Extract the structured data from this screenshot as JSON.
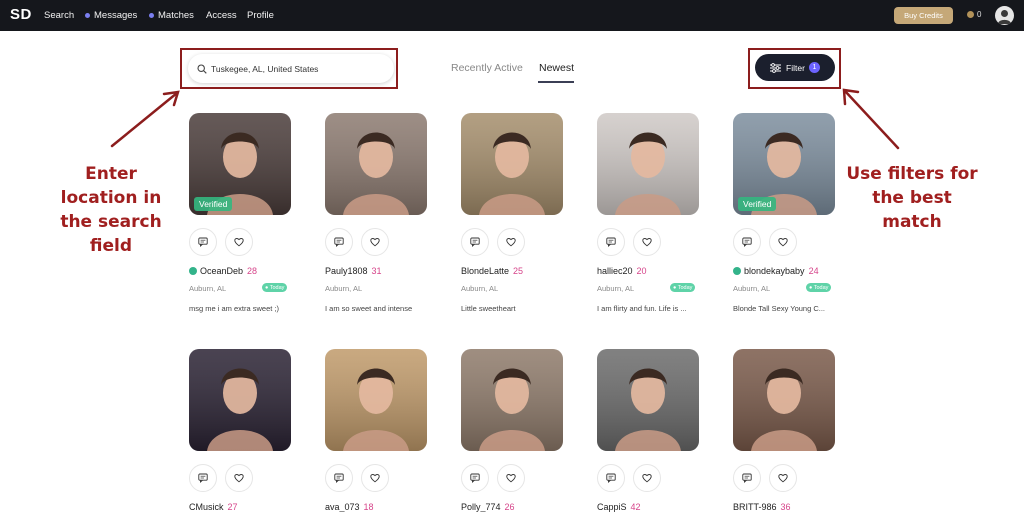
{
  "nav": {
    "logo": "SD",
    "links": [
      {
        "label": "Search",
        "dot": false
      },
      {
        "label": "Messages",
        "dot": true
      },
      {
        "label": "Matches",
        "dot": true
      },
      {
        "label": "Access",
        "dot": false
      },
      {
        "label": "Profile",
        "dot": false
      }
    ],
    "buy_credits": "Buy Credits",
    "credits": "0"
  },
  "search": {
    "value": "Tuskegee, AL, United States",
    "icon": "search-icon"
  },
  "tabs": [
    {
      "label": "Recently Active"
    },
    {
      "label": "Newest",
      "active": true
    }
  ],
  "filter": {
    "label": "Filter",
    "count": "1"
  },
  "annotations": {
    "left": [
      "Enter",
      "location in",
      "the search",
      "field"
    ],
    "right": [
      "Use filters for",
      "the best",
      "match"
    ]
  },
  "colors": {
    "annotation_red": "#8c1d1d",
    "nav_bg": "#15171c",
    "accent_pink": "#d6448a",
    "verified_green": "#34b780"
  },
  "profiles": [
    {
      "name": "OceanDeb",
      "age": "28",
      "location": "Auburn, AL",
      "bio": "msg me i am extra sweet ;)",
      "verified": true,
      "verified_label": "Verified",
      "today": true,
      "today_label": "Today",
      "verified_icon": true,
      "hue": "#4a3c3a"
    },
    {
      "name": "Pauly1808",
      "age": "31",
      "location": "Auburn, AL",
      "bio": "I am so sweet and intense",
      "verified": false,
      "today": false,
      "verified_icon": false,
      "hue": "#8c7a70"
    },
    {
      "name": "BlondeLatte",
      "age": "25",
      "location": "Auburn, AL",
      "bio": "Little sweetheart",
      "verified": false,
      "today": false,
      "verified_icon": false,
      "hue": "#a58e6c"
    },
    {
      "name": "halliec20",
      "age": "20",
      "location": "Auburn, AL",
      "bio": "I am flirty and fun. Life is ...",
      "verified": false,
      "today": true,
      "today_label": "Today",
      "verified_icon": false,
      "hue": "#cfc9c6"
    },
    {
      "name": "blondekaybaby",
      "age": "24",
      "location": "Auburn, AL",
      "bio": "Blonde Tall Sexy Young C...",
      "verified": true,
      "verified_label": "Verified",
      "today": true,
      "today_label": "Today",
      "verified_icon": true,
      "hue": "#7d8e9e"
    },
    {
      "name": "CMusick",
      "age": "27",
      "location": "",
      "bio": "",
      "verified": false,
      "today": false,
      "verified_icon": false,
      "hue": "#2a2233"
    },
    {
      "name": "ava_073",
      "age": "18",
      "location": "",
      "bio": "",
      "verified": false,
      "today": false,
      "verified_icon": false,
      "hue": "#c09a6a"
    },
    {
      "name": "Polly_774",
      "age": "26",
      "location": "",
      "bio": "",
      "verified": false,
      "today": false,
      "verified_icon": false,
      "hue": "#8e7a6a"
    },
    {
      "name": "CappiS",
      "age": "42",
      "location": "",
      "bio": "",
      "verified": false,
      "today": false,
      "verified_icon": false,
      "hue": "#6b6b6b"
    },
    {
      "name": "BRITT-986",
      "age": "36",
      "location": "",
      "bio": "",
      "verified": false,
      "today": false,
      "verified_icon": false,
      "hue": "#7a5a4a"
    }
  ]
}
